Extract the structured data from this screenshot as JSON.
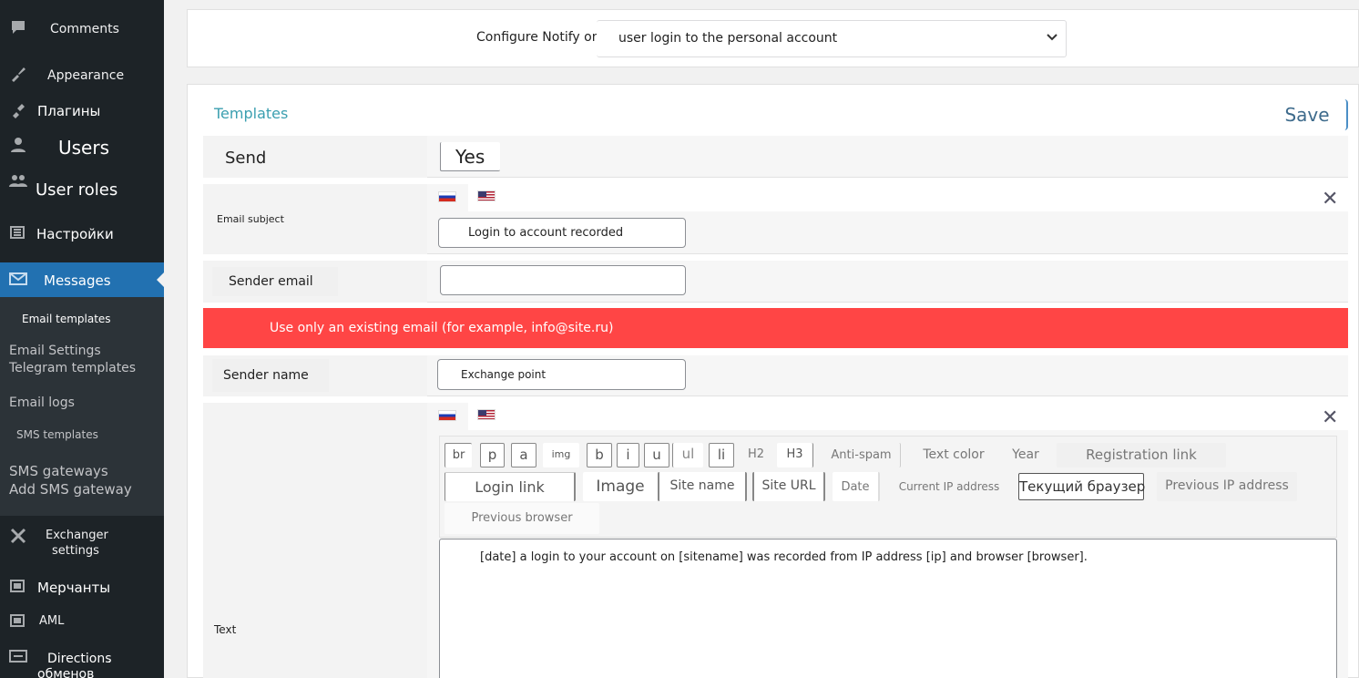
{
  "sidebar": {
    "items": [
      {
        "label": "Comments",
        "icon": "comment-icon"
      },
      {
        "label": "Appearance",
        "icon": "brush-icon"
      },
      {
        "label": "Плагины",
        "icon": "plugin-icon"
      },
      {
        "label": "Users",
        "icon": "user-icon"
      },
      {
        "label": "User roles",
        "icon": "users-icon"
      },
      {
        "label": "Настройки",
        "icon": "settings-icon"
      },
      {
        "label": "Messages",
        "icon": "mail-icon"
      },
      {
        "label": "Exchanger settings",
        "icon": "tools-icon"
      },
      {
        "label": "Мерчанты",
        "icon": "card-icon"
      },
      {
        "label": "AML",
        "icon": "card-icon"
      },
      {
        "label": "Directions",
        "icon": "arrows-icon"
      },
      {
        "label": "обменов",
        "icon": ""
      }
    ],
    "submenu": {
      "email_templates": "Email templates",
      "email_settings": "Email Settings",
      "telegram_templates": "Telegram templates",
      "email_logs": "Email logs",
      "sms_templates": "SMS templates",
      "sms_gateways": "SMS gateways",
      "add_sms_gateway": "Add SMS gateway"
    },
    "exchanger_line1": "Exchanger",
    "exchanger_line2": "settings",
    "directions_suffix": "."
  },
  "config": {
    "label": "Configure Notify on",
    "selected": "user login to the personal account"
  },
  "templates": {
    "title": "Templates",
    "save_label": "Save"
  },
  "rows": {
    "send": {
      "label": "Send",
      "value": "Yes"
    },
    "email_subject": {
      "label": "Email subject",
      "value": "Login to account recorded"
    },
    "sender_email": {
      "label": "Sender email",
      "value": ""
    },
    "warning": "Use only an existing email (for example, info@site.ru)",
    "sender_name": {
      "label": "Sender name",
      "value": "Exchange point"
    },
    "text": {
      "label": "Text",
      "value": "[date] a login to your account on [sitename] was recorded from IP address [ip] and browser [browser]."
    }
  },
  "toolbar": {
    "buttons": {
      "br": "br",
      "p": "p",
      "a": "a",
      "img": "img",
      "b": "b",
      "i": "i",
      "u": "u",
      "ul": "ul",
      "li": "li",
      "h2": "H2",
      "h3": "H3",
      "anti_spam": "Anti-spam",
      "text_color": "Text color",
      "year": "Year",
      "registration_link": "Registration link",
      "login_link": "Login link",
      "image": "Image",
      "site_name": "Site name",
      "site_url": "Site URL",
      "date": "Date",
      "current_ip": "Current IP address",
      "current_browser": "Текущий браузер",
      "previous_ip": "Previous IP address",
      "previous_browser": "Previous browser"
    }
  },
  "colors": {
    "sidebar_bg": "#1d2327",
    "active_item": "#2271b1",
    "warning_bg": "#ff4545",
    "title_accent": "#3b9fb0"
  }
}
